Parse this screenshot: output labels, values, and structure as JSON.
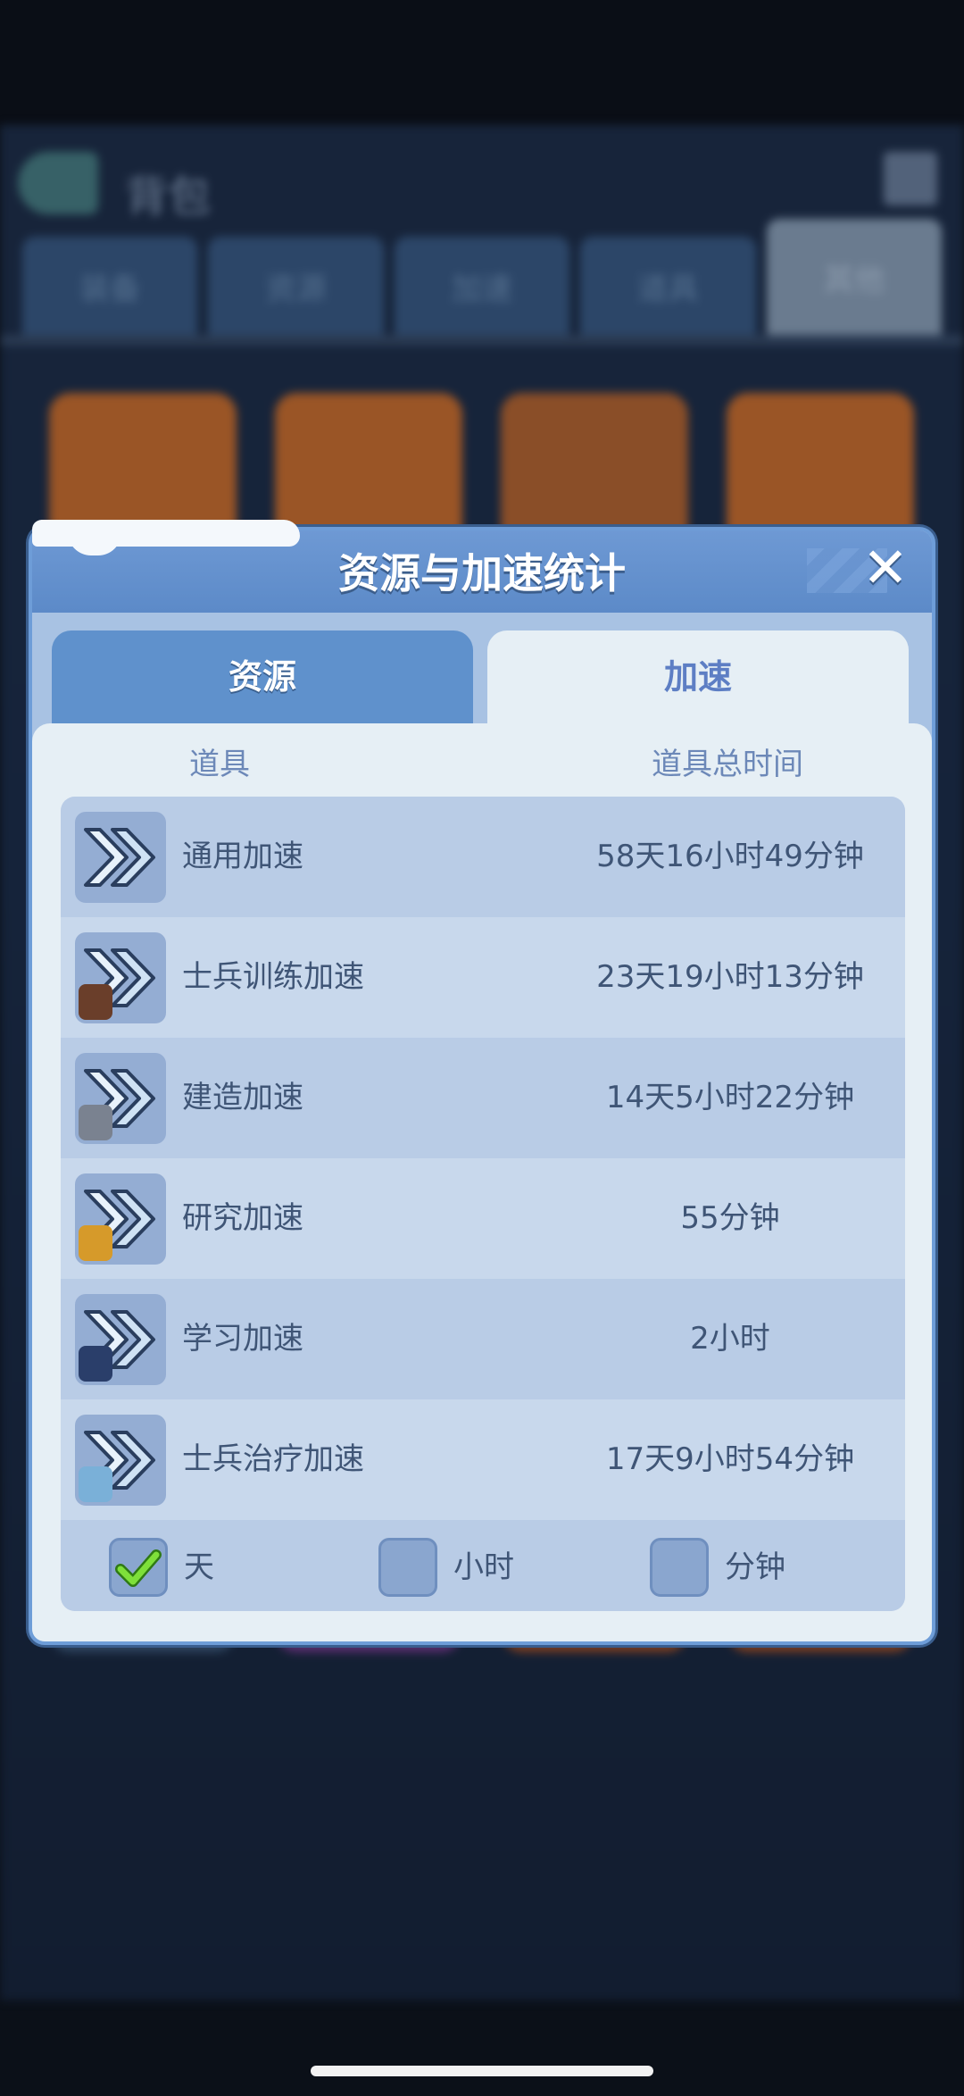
{
  "background": {
    "title": "背包",
    "tabs": [
      "装备",
      "资源",
      "加速",
      "道具",
      "其他"
    ]
  },
  "dialog": {
    "title": "资源与加速统计",
    "tabs": {
      "resources": "资源",
      "speedups": "加速"
    },
    "active_tab": "speedups",
    "columns": {
      "item": "道具",
      "total_time": "道具总时间"
    },
    "rows": [
      {
        "name": "通用加速",
        "icon": "general-speedup-icon",
        "time": "58天16小时49分钟"
      },
      {
        "name": "士兵训练加速",
        "icon": "training-speedup-icon",
        "time": "23天19小时13分钟"
      },
      {
        "name": "建造加速",
        "icon": "building-speedup-icon",
        "time": "14天5小时22分钟"
      },
      {
        "name": "研究加速",
        "icon": "research-speedup-icon",
        "time": "55分钟"
      },
      {
        "name": "学习加速",
        "icon": "learning-speedup-icon",
        "time": "2小时"
      },
      {
        "name": "士兵治疗加速",
        "icon": "healing-speedup-icon",
        "time": "17天9小时54分钟"
      }
    ],
    "units": [
      {
        "label": "天",
        "checked": true
      },
      {
        "label": "小时",
        "checked": false
      },
      {
        "label": "分钟",
        "checked": false
      }
    ]
  }
}
